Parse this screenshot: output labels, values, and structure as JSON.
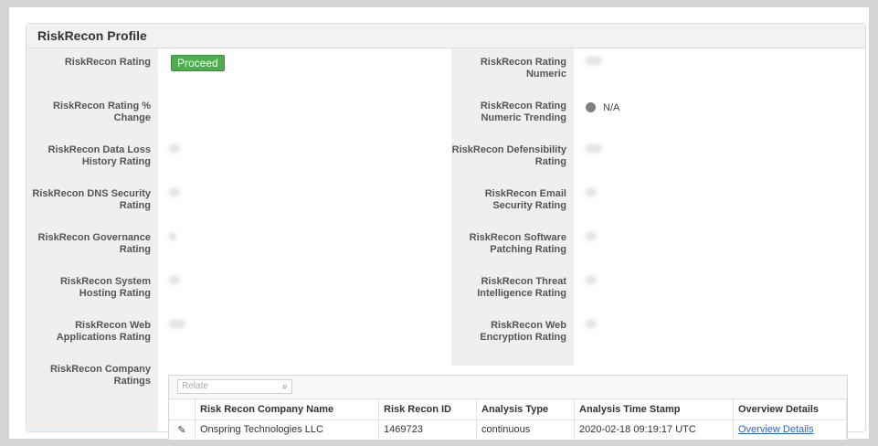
{
  "panel": {
    "title": "RiskRecon Profile"
  },
  "left_fields": [
    {
      "label": "RiskRecon Rating",
      "value": "Proceed"
    },
    {
      "label": "RiskRecon Rating % Change",
      "value": ""
    },
    {
      "label": "RiskRecon Data Loss History Rating",
      "value": ""
    },
    {
      "label": "RiskRecon DNS Security Rating",
      "value": ""
    },
    {
      "label": "RiskRecon Governance Rating",
      "value": ""
    },
    {
      "label": "RiskRecon System Hosting Rating",
      "value": ""
    },
    {
      "label": "RiskRecon Web Applications Rating",
      "value": ""
    },
    {
      "label": "RiskRecon Company Ratings",
      "value": ""
    }
  ],
  "right_fields": [
    {
      "label": "RiskRecon Rating Numeric",
      "value": ""
    },
    {
      "label": "RiskRecon Rating Numeric Trending",
      "value": "N/A"
    },
    {
      "label": "RiskRecon Defensibility Rating",
      "value": ""
    },
    {
      "label": "RiskRecon Email Security Rating",
      "value": ""
    },
    {
      "label": "RiskRecon Software Patching Rating",
      "value": ""
    },
    {
      "label": "RiskRecon Threat Intelligence Rating",
      "value": ""
    },
    {
      "label": "RiskRecon Web Encryption Rating",
      "value": ""
    }
  ],
  "ratings": {
    "search_placeholder": "Relate",
    "columns": [
      "Risk Recon Company Name",
      "Risk Recon ID",
      "Analysis Type",
      "Analysis Time Stamp",
      "Overview Details"
    ],
    "rows": [
      {
        "company": "Onspring Technologies LLC",
        "id": "1469723",
        "type": "continuous",
        "timestamp": "2020-02-18 09:19:17 UTC",
        "details": "Overview Details"
      }
    ]
  },
  "colors": {
    "badge_green": "#4cae4c",
    "link_blue": "#2a64c5",
    "label_bg": "#efefef"
  },
  "icons": {
    "search": "search-icon",
    "edit": "pencil-icon",
    "trend": "gray-dot-icon"
  }
}
